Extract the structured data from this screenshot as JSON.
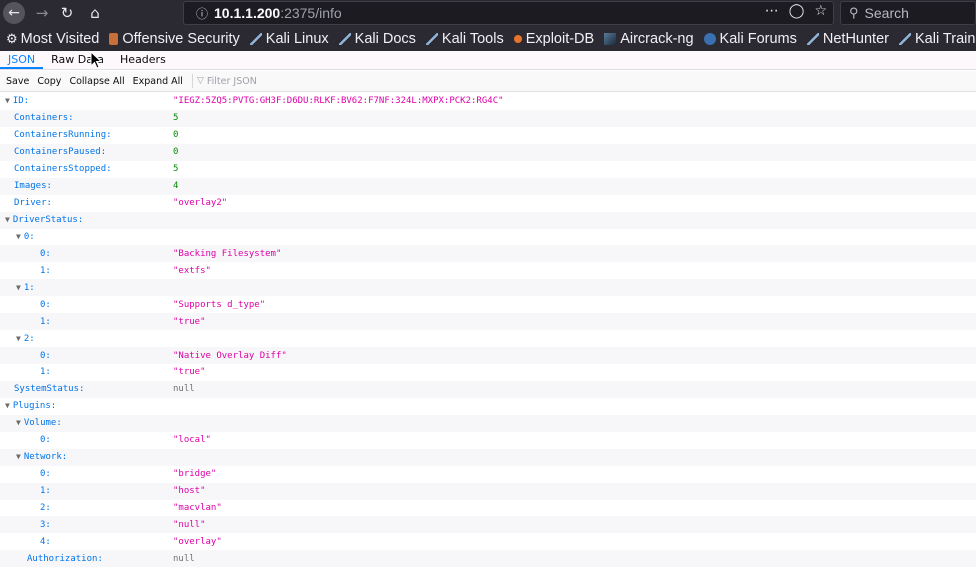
{
  "browser": {
    "url_host": "10.1.1.200",
    "url_rest": ":2375/info",
    "search_placeholder": "Search"
  },
  "bookmarks": [
    {
      "label": "Most Visited",
      "icon": "gear-icon"
    },
    {
      "label": "Offensive Security",
      "icon": "offsec-icon"
    },
    {
      "label": "Kali Linux",
      "icon": "kali-dragon-icon"
    },
    {
      "label": "Kali Docs",
      "icon": "kali-dragon-icon"
    },
    {
      "label": "Kali Tools",
      "icon": "kali-dragon-icon"
    },
    {
      "label": "Exploit-DB",
      "icon": "exploit-db-icon"
    },
    {
      "label": "Aircrack-ng",
      "icon": "aircrack-icon"
    },
    {
      "label": "Kali Forums",
      "icon": "kali-forums-icon"
    },
    {
      "label": "NetHunter",
      "icon": "kali-dragon-icon"
    },
    {
      "label": "Kali Training",
      "icon": "kali-dragon-icon"
    }
  ],
  "viewer_tabs": [
    "JSON",
    "Raw Data",
    "Headers"
  ],
  "toolbar": {
    "save": "Save",
    "copy": "Copy",
    "collapse_all": "Collapse All",
    "expand_all": "Expand All",
    "filter_placeholder": "Filter JSON"
  },
  "rows": [
    {
      "key": "ID:",
      "value": "\"IEGZ:5ZQ5:PVTG:GH3F:D6DU:RLKF:BV62:F7NF:324L:MXPX:PCK2:RG4C\"",
      "type": "string",
      "level": 0,
      "expandable": true
    },
    {
      "key": "Containers:",
      "value": "5",
      "type": "number",
      "level": 0
    },
    {
      "key": "ContainersRunning:",
      "value": "0",
      "type": "number",
      "level": 0
    },
    {
      "key": "ContainersPaused:",
      "value": "0",
      "type": "number",
      "level": 0
    },
    {
      "key": "ContainersStopped:",
      "value": "5",
      "type": "number",
      "level": 0
    },
    {
      "key": "Images:",
      "value": "4",
      "type": "number",
      "level": 0
    },
    {
      "key": "Driver:",
      "value": "\"overlay2\"",
      "type": "string",
      "level": 0
    },
    {
      "key": "DriverStatus:",
      "value": "",
      "type": "object",
      "level": 0,
      "expandable": true
    },
    {
      "key": "0:",
      "value": "",
      "type": "object",
      "level": 1,
      "expandable": true
    },
    {
      "key": "0:",
      "value": "\"Backing Filesystem\"",
      "type": "string",
      "level": 2
    },
    {
      "key": "1:",
      "value": "\"extfs\"",
      "type": "string",
      "level": 2
    },
    {
      "key": "1:",
      "value": "",
      "type": "object",
      "level": 1,
      "expandable": true
    },
    {
      "key": "0:",
      "value": "\"Supports d_type\"",
      "type": "string",
      "level": 2
    },
    {
      "key": "1:",
      "value": "\"true\"",
      "type": "string",
      "level": 2
    },
    {
      "key": "2:",
      "value": "",
      "type": "object",
      "level": 1,
      "expandable": true
    },
    {
      "key": "0:",
      "value": "\"Native Overlay Diff\"",
      "type": "string",
      "level": 2
    },
    {
      "key": "1:",
      "value": "\"true\"",
      "type": "string",
      "level": 2
    },
    {
      "key": "SystemStatus:",
      "value": "null",
      "type": "null",
      "level": 0
    },
    {
      "key": "Plugins:",
      "value": "",
      "type": "object",
      "level": 0,
      "expandable": true
    },
    {
      "key": "Volume:",
      "value": "",
      "type": "object",
      "level": 1,
      "expandable": true
    },
    {
      "key": "0:",
      "value": "\"local\"",
      "type": "string",
      "level": 2
    },
    {
      "key": "Network:",
      "value": "",
      "type": "object",
      "level": 1,
      "expandable": true
    },
    {
      "key": "0:",
      "value": "\"bridge\"",
      "type": "string",
      "level": 2
    },
    {
      "key": "1:",
      "value": "\"host\"",
      "type": "string",
      "level": 2
    },
    {
      "key": "2:",
      "value": "\"macvlan\"",
      "type": "string",
      "level": 2
    },
    {
      "key": "3:",
      "value": "\"null\"",
      "type": "string",
      "level": 2
    },
    {
      "key": "4:",
      "value": "\"overlay\"",
      "type": "string",
      "level": 2
    },
    {
      "key": "Authorization:",
      "value": "null",
      "type": "null",
      "level": 1
    }
  ],
  "colors": {
    "key": "#0074e8",
    "string": "#dd00a9",
    "number": "#058b00",
    "null": "#737373",
    "tab_active": "#0a84ff"
  }
}
